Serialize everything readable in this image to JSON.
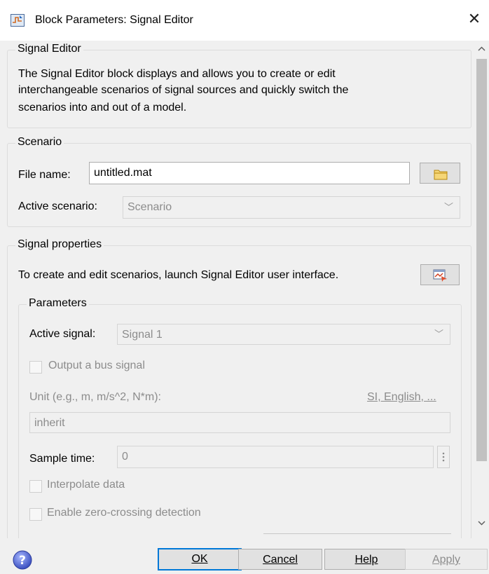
{
  "window": {
    "title": "Block Parameters: Signal Editor",
    "close_glyph": "✕",
    "icon": "simulink-block-icon"
  },
  "signal_editor": {
    "legend": "Signal Editor",
    "description_lines": [
      "The Signal Editor block displays and allows you to create or edit",
      "interchangeable scenarios of signal sources and quickly switch the",
      "scenarios into and out of a model."
    ]
  },
  "scenario": {
    "legend": "Scenario",
    "file_name_label": "File name:",
    "file_name_value": "untitled.mat",
    "browse_icon": "folder-icon",
    "active_scenario_label": "Active scenario:",
    "active_scenario_value": "Scenario"
  },
  "signal_properties": {
    "legend": "Signal properties",
    "launch_text": "To create and edit scenarios, launch Signal Editor user interface.",
    "launch_icon": "signal-editor-launch-icon",
    "parameters": {
      "legend": "Parameters",
      "active_signal_label": "Active signal:",
      "active_signal_value": "Signal 1",
      "output_bus_label": "Output a bus signal",
      "unit_label": "Unit (e.g., m, m/s^2, N*m):",
      "unit_link": "SI, English, ...",
      "unit_value": "inherit",
      "sample_time_label": "Sample time:",
      "sample_time_value": "0",
      "interpolate_label": "Interpolate data",
      "zero_crossing_label": "Enable zero-crossing detection"
    }
  },
  "footer": {
    "help_icon": "help-icon",
    "ok_label": "OK",
    "cancel_label": "Cancel",
    "help_label": "Help",
    "apply_label": "Apply"
  },
  "colors": {
    "focus_border": "#0078d7",
    "disabled_text": "#8c8c8c",
    "dialog_bg": "#f0f0f0"
  }
}
